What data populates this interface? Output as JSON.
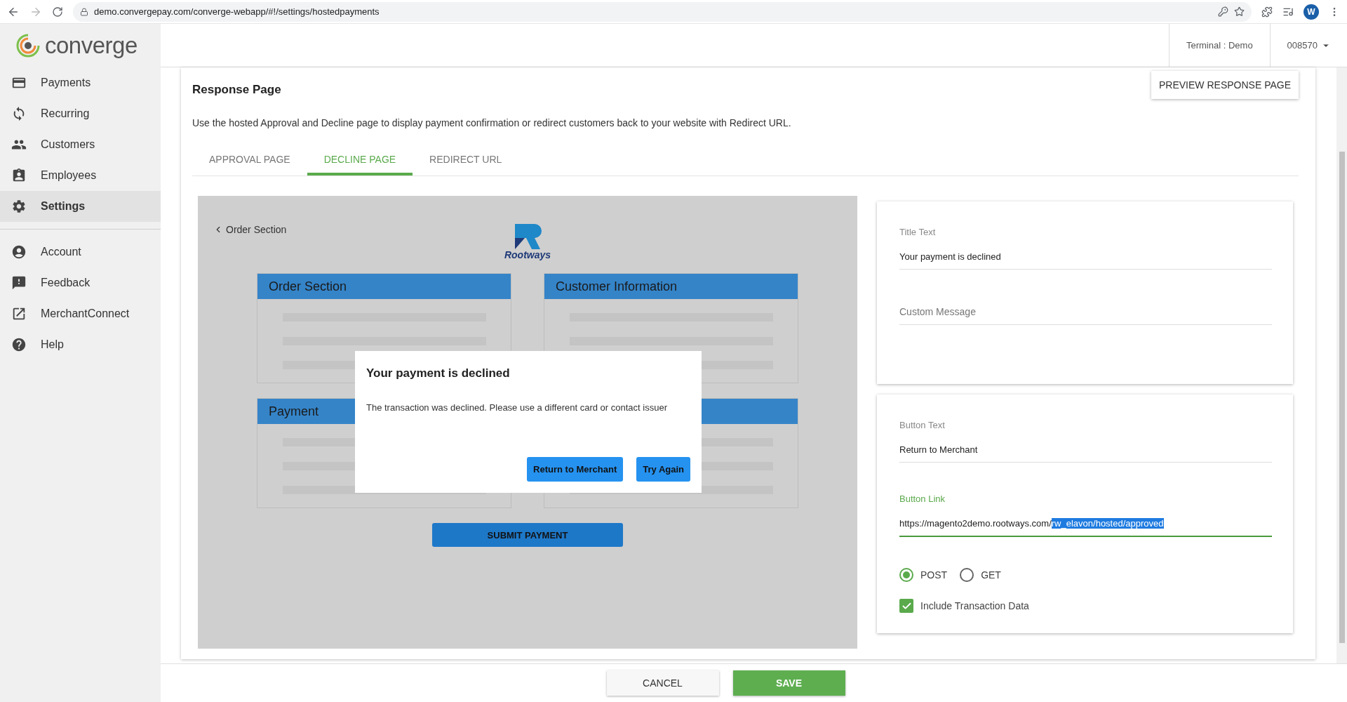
{
  "browser": {
    "url": "demo.convergepay.com/converge-webapp/#!/settings/hostedpayments",
    "profile_initial": "W"
  },
  "sidebar": {
    "logo": "converge",
    "items": [
      {
        "label": "Payments",
        "selected": false
      },
      {
        "label": "Recurring",
        "selected": false
      },
      {
        "label": "Customers",
        "selected": false
      },
      {
        "label": "Employees",
        "selected": false
      },
      {
        "label": "Settings",
        "selected": true
      }
    ],
    "secondary_items": [
      {
        "label": "Account",
        "selected": false
      },
      {
        "label": "Feedback",
        "selected": false
      },
      {
        "label": "MerchantConnect",
        "selected": false
      },
      {
        "label": "Help",
        "selected": false
      }
    ]
  },
  "header": {
    "terminal": "Terminal : Demo",
    "account": "008570"
  },
  "section": {
    "title": "Response Page",
    "description": "Use the hosted Approval and Decline page to display payment confirmation or redirect customers back to your website with Redirect URL.",
    "preview_button": "PREVIEW RESPONSE PAGE"
  },
  "tabs": [
    {
      "label": "APPROVAL PAGE",
      "selected": false
    },
    {
      "label": "DECLINE PAGE",
      "selected": true
    },
    {
      "label": "REDIRECT URL",
      "selected": false
    }
  ],
  "preview": {
    "back_link": "Order Section",
    "logo_text": "Rootways",
    "cards": [
      {
        "kind": "titled",
        "title": "Order Section"
      },
      {
        "kind": "titled",
        "title": "Customer Information"
      },
      {
        "kind": "titled",
        "title": "Payment"
      },
      {
        "kind": "covered"
      }
    ],
    "submit_button": "SUBMIT PAYMENT",
    "dialog": {
      "title": "Your payment is declined",
      "message": "The transaction was declined. Please use a different card or contact issuer",
      "buttons": [
        "Return to Merchant",
        "Try Again"
      ]
    }
  },
  "title_card": {
    "fields": [
      {
        "label": "Title Text",
        "value": "Your payment is declined",
        "focused": false
      },
      {
        "placeholder": "Custom Message",
        "focused": false
      }
    ]
  },
  "button_card": {
    "fields": [
      {
        "label": "Button Text",
        "value": "Return to Merchant",
        "focused": false
      },
      {
        "label": "Button Link",
        "value": "https://magento2demo.rootways.com/",
        "selected_text": "rw_elavon/hosted/approved",
        "focused": true
      }
    ],
    "methods": [
      {
        "label": "POST",
        "selected": true
      },
      {
        "label": "GET",
        "selected": false
      }
    ],
    "include_data": {
      "label": "Include Transaction Data",
      "checked": true
    }
  },
  "footer": {
    "cancel": "CANCEL",
    "save": "SAVE"
  }
}
